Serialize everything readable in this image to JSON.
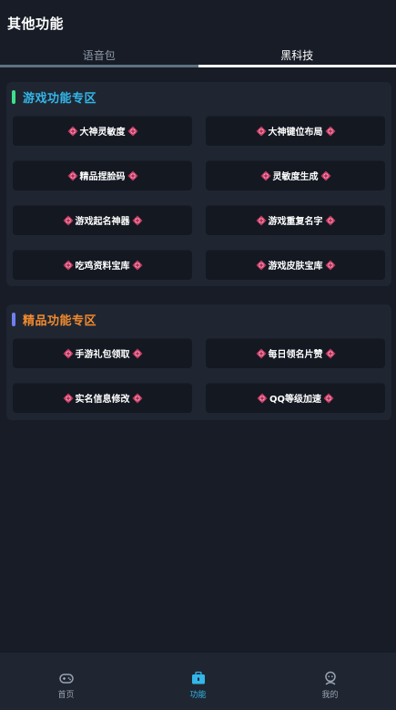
{
  "header": {
    "title": "其他功能"
  },
  "tabs": [
    {
      "label": "语音包",
      "active": false
    },
    {
      "label": "黑科技",
      "active": true
    }
  ],
  "sections": [
    {
      "title": "游戏功能专区",
      "title_color": "#33b6e8",
      "bar_color": "#3ee08a",
      "items": [
        {
          "label": "大神灵敏度"
        },
        {
          "label": "大神键位布局"
        },
        {
          "label": "精品捏脸码"
        },
        {
          "label": "灵敏度生成"
        },
        {
          "label": "游戏起名神器"
        },
        {
          "label": "游戏重复名字"
        },
        {
          "label": "吃鸡资料宝库"
        },
        {
          "label": "游戏皮肤宝库"
        }
      ]
    },
    {
      "title": "精品功能专区",
      "title_color": "#f28a2e",
      "bar_color": "#6f7ff2",
      "items": [
        {
          "label": "手游礼包领取"
        },
        {
          "label": "每日领名片赞"
        },
        {
          "label": "实名信息修改"
        },
        {
          "label": "QQ等级加速"
        }
      ]
    }
  ],
  "bottom_nav": [
    {
      "label": "首页",
      "icon": "gamepad-icon",
      "active": false
    },
    {
      "label": "功能",
      "icon": "toolbox-icon",
      "active": true
    },
    {
      "label": "我的",
      "icon": "profile-icon",
      "active": false
    }
  ],
  "colors": {
    "background": "#171c26",
    "card": "#1f2632",
    "button": "#131821",
    "gem": "#d6406b",
    "active_accent": "#33b6e8"
  }
}
